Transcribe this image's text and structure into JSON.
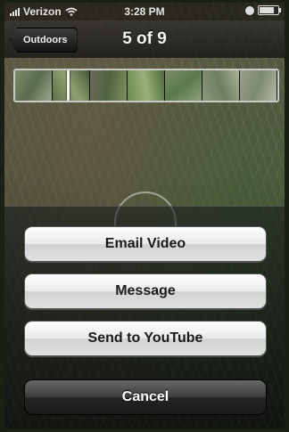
{
  "status_bar": {
    "carrier": "Verizon",
    "time": "3:28 PM"
  },
  "nav": {
    "back_label": "Outdoors",
    "title": "5 of 9"
  },
  "action_sheet": {
    "email_label": "Email Video",
    "message_label": "Message",
    "youtube_label": "Send to YouTube",
    "cancel_label": "Cancel"
  },
  "colors": {
    "light_button": "#e9e9e9",
    "dark_button": "#2a2a2a"
  }
}
